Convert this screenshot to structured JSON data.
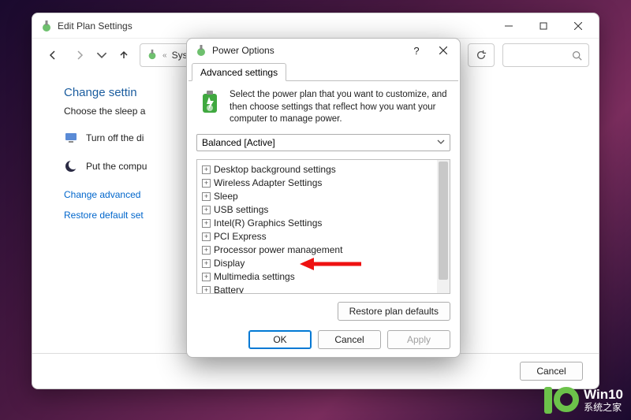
{
  "parent": {
    "title": "Edit Plan Settings",
    "breadcrumb": "Syste",
    "heading": "Change settin",
    "subtext": "Choose the sleep a",
    "row1": "Turn off the di",
    "row2": "Put the compu",
    "link1": "Change advanced",
    "link2": "Restore default set",
    "cancel": "Cancel"
  },
  "dialog": {
    "title": "Power Options",
    "tab": "Advanced settings",
    "description": "Select the power plan that you want to customize, and then choose settings that reflect how you want your computer to manage power.",
    "plan": "Balanced [Active]",
    "restore": "Restore plan defaults",
    "ok": "OK",
    "cancel": "Cancel",
    "apply": "Apply"
  },
  "tree": [
    "Desktop background settings",
    "Wireless Adapter Settings",
    "Sleep",
    "USB settings",
    "Intel(R) Graphics Settings",
    "PCI Express",
    "Processor power management",
    "Display",
    "Multimedia settings",
    "Battery"
  ],
  "watermark": {
    "l1": "Win10",
    "l2": "系统之家"
  }
}
